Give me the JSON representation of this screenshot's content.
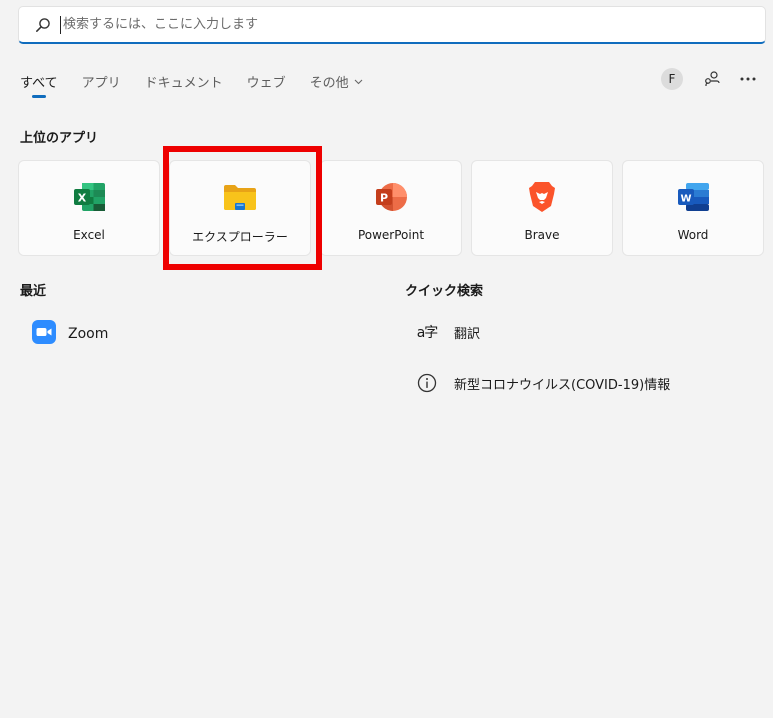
{
  "search": {
    "placeholder": "検索するには、ここに入力します"
  },
  "tabs": [
    {
      "label": "すべて"
    },
    {
      "label": "アプリ"
    },
    {
      "label": "ドキュメント"
    },
    {
      "label": "ウェブ"
    },
    {
      "label": "その他"
    }
  ],
  "account": {
    "initial": "F"
  },
  "top_apps": {
    "title": "上位のアプリ",
    "items": [
      {
        "label": "Excel"
      },
      {
        "label": "エクスプローラー"
      },
      {
        "label": "PowerPoint"
      },
      {
        "label": "Brave"
      },
      {
        "label": "Word"
      }
    ]
  },
  "recent": {
    "title": "最近",
    "items": [
      {
        "label": "Zoom"
      }
    ]
  },
  "quick_search": {
    "title": "クイック検索",
    "items": [
      {
        "glyph": "a字",
        "label": "翻訳"
      },
      {
        "label": "新型コロナウイルス(COVID-19)情報"
      }
    ]
  },
  "colors": {
    "accent": "#0f6cbd",
    "highlight": "#ee0000",
    "excel": "#107c41",
    "powerpoint": "#c43e1c",
    "word": "#185abd",
    "brave": "#fb542b",
    "zoom": "#2d8cff",
    "explorer": "#f8c31b"
  },
  "icons": {
    "search": "search-icon",
    "chevron": "chevron-down-icon",
    "share": "share-network-icon",
    "more": "more-icon",
    "excel": "excel-icon",
    "explorer": "file-explorer-icon",
    "powerpoint": "powerpoint-icon",
    "brave": "brave-icon",
    "word": "word-icon",
    "zoom": "zoom-icon",
    "translate": "translate-icon",
    "info": "info-icon"
  }
}
